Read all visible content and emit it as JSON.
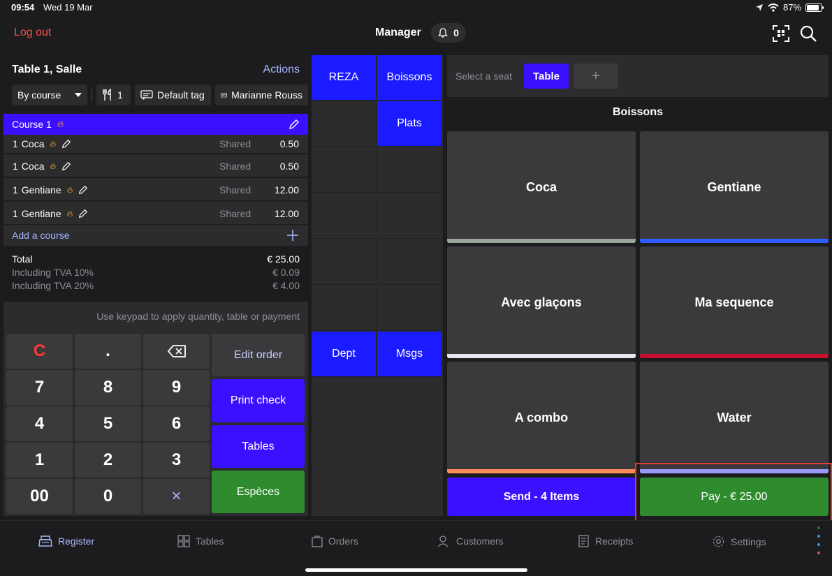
{
  "status": {
    "time": "09:54",
    "date": "Wed 19 Mar",
    "battery": "87%"
  },
  "topbar": {
    "logout": "Log out",
    "user": "Manager",
    "notifications": "0"
  },
  "order": {
    "title": "Table 1, Salle",
    "actions": "Actions",
    "view_mode": "By course",
    "guests": "1",
    "tag": "Default tag",
    "customer": "Marianne Rouss",
    "course_label": "Course 1",
    "lines": [
      {
        "qty": "1",
        "name": "Coca",
        "seat": "Shared",
        "price": "0.50"
      },
      {
        "qty": "1",
        "name": "Coca",
        "seat": "Shared",
        "price": "0.50"
      },
      {
        "qty": "1",
        "name": "Gentiane",
        "seat": "Shared",
        "price": "12.00"
      },
      {
        "qty": "1",
        "name": "Gentiane",
        "seat": "Shared",
        "price": "12.00"
      }
    ],
    "add_course": "Add a course",
    "total_label": "Total",
    "total_value": "€ 25.00",
    "tva10_label": "Including TVA 10%",
    "tva10_value": "€ 0.09",
    "tva20_label": "Including TVA 20%",
    "tva20_value": "€ 4.00"
  },
  "keypad": {
    "hint": "Use keypad to apply quantity, table or payment",
    "clear": "C",
    "dot": ".",
    "keys": [
      "7",
      "8",
      "9",
      "4",
      "5",
      "6",
      "1",
      "2",
      "3"
    ],
    "double_zero": "00",
    "zero": "0",
    "multiply": "×",
    "edit_order": "Edit order",
    "print_check": "Print check",
    "tables": "Tables",
    "cash": "Espèces"
  },
  "categories": {
    "reza": "REZA",
    "boissons": "Boissons",
    "plats": "Plats",
    "dept": "Dept",
    "msgs": "Msgs"
  },
  "seats": {
    "label": "Select a seat",
    "table": "Table",
    "add": "+"
  },
  "products": {
    "section": "Boissons",
    "items": [
      {
        "name": "Coca",
        "color": "#9aa59a"
      },
      {
        "name": "Gentiane",
        "color": "#2f5bff"
      },
      {
        "name": "Avec glaçons",
        "color": "#e6e6f0"
      },
      {
        "name": "Ma sequence",
        "color": "#c8102e"
      },
      {
        "name": "A combo",
        "color": "#ff8a5c"
      },
      {
        "name": "Water",
        "color": "#9b9bff"
      }
    ]
  },
  "send_button": "Send - 4 Items",
  "pay_button": "Pay - € 25.00",
  "tabs": {
    "register": "Register",
    "tables": "Tables",
    "orders": "Orders",
    "customers": "Customers",
    "receipts": "Receipts",
    "settings": "Settings"
  },
  "colors": {
    "accent": "#3a10ff",
    "green": "#2e8b2e",
    "link": "#a7b7ff",
    "danger": "#ff4c4c"
  }
}
